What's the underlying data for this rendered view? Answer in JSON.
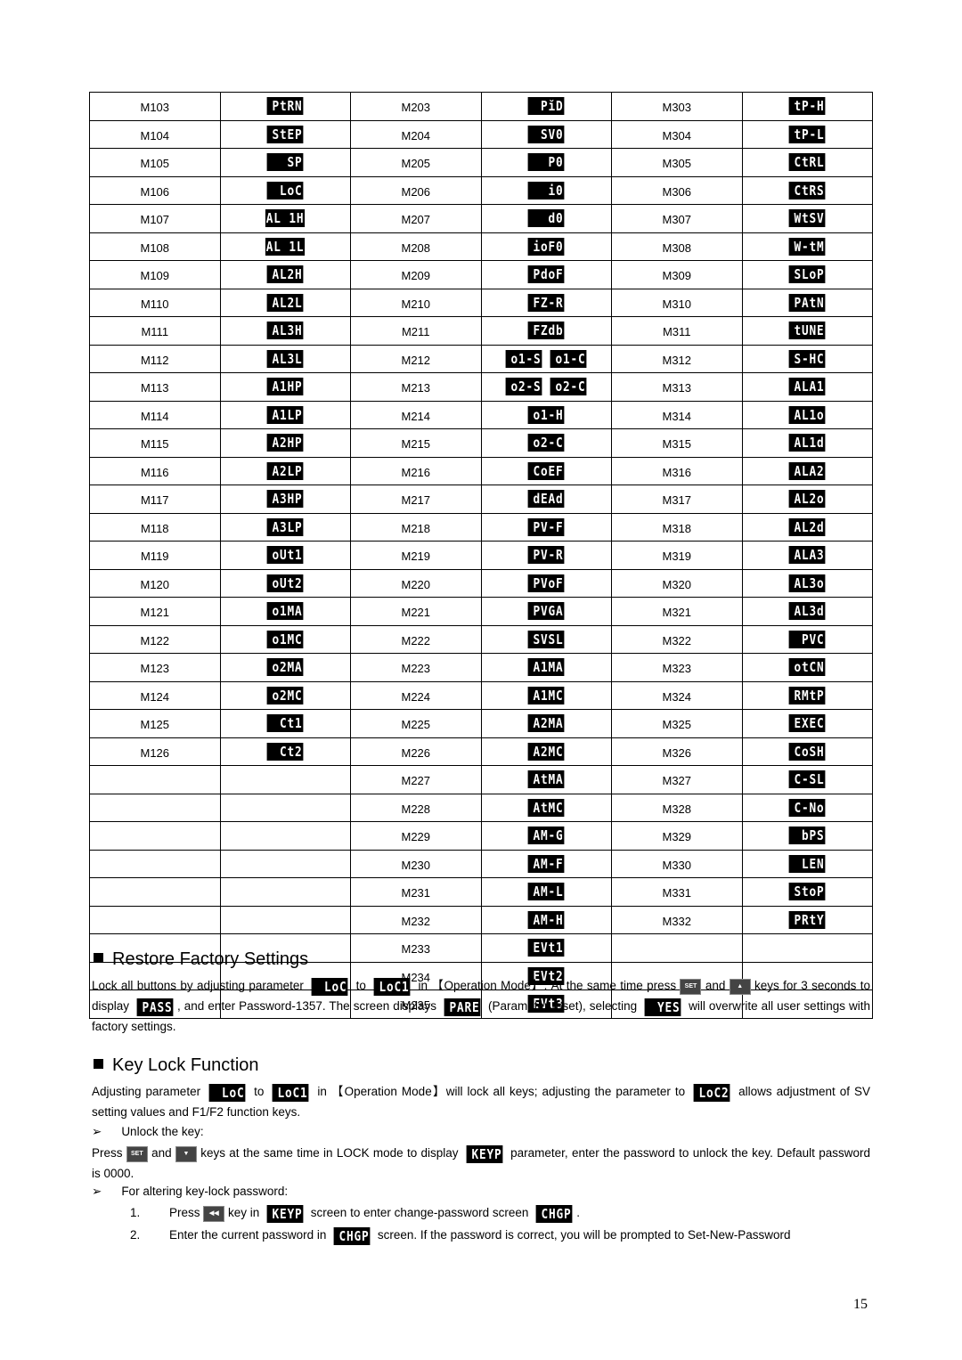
{
  "table": {
    "rows": [
      [
        [
          "M103",
          "PtRN"
        ],
        [
          "M203",
          "PĭD"
        ],
        [
          "M303",
          "tP-H"
        ]
      ],
      [
        [
          "M104",
          "StEP"
        ],
        [
          "M204",
          "SV0"
        ],
        [
          "M304",
          "tP-L"
        ]
      ],
      [
        [
          "M105",
          "SP"
        ],
        [
          "M205",
          "P0"
        ],
        [
          "M305",
          "CtRL"
        ]
      ],
      [
        [
          "M106",
          "LoC"
        ],
        [
          "M206",
          "i0"
        ],
        [
          "M306",
          "CtRS"
        ]
      ],
      [
        [
          "M107",
          "AL 1H"
        ],
        [
          "M207",
          "d0"
        ],
        [
          "M307",
          "WtSV"
        ]
      ],
      [
        [
          "M108",
          "AL 1L"
        ],
        [
          "M208",
          "ioF0"
        ],
        [
          "M308",
          "W-tM"
        ]
      ],
      [
        [
          "M109",
          "AL2H"
        ],
        [
          "M209",
          "PdoF"
        ],
        [
          "M309",
          "SLoP"
        ]
      ],
      [
        [
          "M110",
          "AL2L"
        ],
        [
          "M210",
          "FZ-R"
        ],
        [
          "M310",
          "PAtN"
        ]
      ],
      [
        [
          "M111",
          "AL3H"
        ],
        [
          "M211",
          "FZdb"
        ],
        [
          "M311",
          "tUNE"
        ]
      ],
      [
        [
          "M112",
          "AL3L"
        ],
        [
          "M212",
          [
            "o1-S",
            "o1-C"
          ]
        ],
        [
          "M312",
          "S-HC"
        ]
      ],
      [
        [
          "M113",
          "A1HP"
        ],
        [
          "M213",
          [
            "o2-S",
            "o2-C"
          ]
        ],
        [
          "M313",
          "ALA1"
        ]
      ],
      [
        [
          "M114",
          "A1LP"
        ],
        [
          "M214",
          "o1-H"
        ],
        [
          "M314",
          "AL1o"
        ]
      ],
      [
        [
          "M115",
          "A2HP"
        ],
        [
          "M215",
          "o2-C"
        ],
        [
          "M315",
          "AL1d"
        ]
      ],
      [
        [
          "M116",
          "A2LP"
        ],
        [
          "M216",
          "CoEF"
        ],
        [
          "M316",
          "ALA2"
        ]
      ],
      [
        [
          "M117",
          "A3HP"
        ],
        [
          "M217",
          "dEAd"
        ],
        [
          "M317",
          "AL2o"
        ]
      ],
      [
        [
          "M118",
          "A3LP"
        ],
        [
          "M218",
          "PV-F"
        ],
        [
          "M318",
          "AL2d"
        ]
      ],
      [
        [
          "M119",
          "oUt1"
        ],
        [
          "M219",
          "PV-R"
        ],
        [
          "M319",
          "ALA3"
        ]
      ],
      [
        [
          "M120",
          "oUt2"
        ],
        [
          "M220",
          "PVoF"
        ],
        [
          "M320",
          "AL3o"
        ]
      ],
      [
        [
          "M121",
          "o1MA"
        ],
        [
          "M221",
          "PVGA"
        ],
        [
          "M321",
          "AL3d"
        ]
      ],
      [
        [
          "M122",
          "o1MC"
        ],
        [
          "M222",
          "SVSL"
        ],
        [
          "M322",
          "PVC"
        ]
      ],
      [
        [
          "M123",
          "o2MA"
        ],
        [
          "M223",
          "A1MA"
        ],
        [
          "M323",
          "otCN"
        ]
      ],
      [
        [
          "M124",
          "o2MC"
        ],
        [
          "M224",
          "A1MC"
        ],
        [
          "M324",
          "RMtP"
        ]
      ],
      [
        [
          "M125",
          "Ct1"
        ],
        [
          "M225",
          "A2MA"
        ],
        [
          "M325",
          "EXEC"
        ]
      ],
      [
        [
          "M126",
          "Ct2"
        ],
        [
          "M226",
          "A2MC"
        ],
        [
          "M326",
          "CoSH"
        ]
      ],
      [
        [
          "",
          ""
        ],
        [
          "M227",
          "AtMA"
        ],
        [
          "M327",
          "C-SL"
        ]
      ],
      [
        [
          "",
          ""
        ],
        [
          "M228",
          "AtMC"
        ],
        [
          "M328",
          "C-No"
        ]
      ],
      [
        [
          "",
          ""
        ],
        [
          "M229",
          "AM-G"
        ],
        [
          "M329",
          "bPS"
        ]
      ],
      [
        [
          "",
          ""
        ],
        [
          "M230",
          "AM-F"
        ],
        [
          "M330",
          "LEN"
        ]
      ],
      [
        [
          "",
          ""
        ],
        [
          "M231",
          "AM-L"
        ],
        [
          "M331",
          "StoP"
        ]
      ],
      [
        [
          "",
          ""
        ],
        [
          "M232",
          "AM-H"
        ],
        [
          "M332",
          "PRtY"
        ]
      ],
      [
        [
          "",
          ""
        ],
        [
          "M233",
          "EVt1"
        ],
        [
          "",
          ""
        ]
      ],
      [
        [
          "",
          ""
        ],
        [
          "M234",
          "EVt2"
        ],
        [
          "",
          ""
        ]
      ],
      [
        [
          "",
          ""
        ],
        [
          "M235",
          "EVt3"
        ],
        [
          "",
          ""
        ]
      ]
    ]
  },
  "restore": {
    "title": "Restore Factory Settings",
    "body": [
      {
        "t": "Lock all buttons by adjusting parameter "
      },
      {
        "d": "LoC"
      },
      {
        "t": " to "
      },
      {
        "d": "LoC1"
      },
      {
        "t": " in 【Operation Mode】. At the same time press "
      },
      {
        "k": "SET"
      },
      {
        "t": " and "
      },
      {
        "k": "▲"
      },
      {
        "t": " keys for 3 seconds to display "
      },
      {
        "d": "PASS"
      },
      {
        "t": ", and enter Password-1357. The screen displays "
      },
      {
        "d": "PARE"
      },
      {
        "t": " (Parameter reset), selecting "
      },
      {
        "d": "YES"
      },
      {
        "t": " will overwrite all user settings with factory settings."
      }
    ]
  },
  "keylock": {
    "title": "Key Lock Function",
    "body": [
      {
        "t": "Adjusting parameter "
      },
      {
        "d": "LoC"
      },
      {
        "t": " to "
      },
      {
        "d": "LoC1"
      },
      {
        "t": " in 【Operation Mode】will lock all keys; adjusting the parameter to "
      },
      {
        "d": "LoC2"
      },
      {
        "t": " allows adjustment of SV setting values and F1/F2 function keys."
      }
    ],
    "unlock_title": "Unlock the key:",
    "unlock_body": [
      {
        "t": "Press "
      },
      {
        "k": "SET"
      },
      {
        "t": " and "
      },
      {
        "k": "▼"
      },
      {
        "t": " keys at the same time in LOCK mode to display "
      },
      {
        "d": "KEYP"
      },
      {
        "t": " parameter, enter the password to unlock the key. Default password is 0000."
      }
    ],
    "alter_title": "For altering key-lock password:",
    "step1_num": "1.",
    "step1": [
      {
        "t": "Press "
      },
      {
        "k": "◀◀"
      },
      {
        "t": " key in "
      },
      {
        "d": "KEYP"
      },
      {
        "t": " screen to enter change-password screen "
      },
      {
        "d": "CHGP"
      },
      {
        "t": "."
      }
    ],
    "step2_num": "2.",
    "step2": [
      {
        "t": "Enter the current password in "
      },
      {
        "d": "CHGP"
      },
      {
        "t": " screen. If the password is correct, you will be prompted to Set-New-Password"
      }
    ]
  },
  "page_number": "15"
}
